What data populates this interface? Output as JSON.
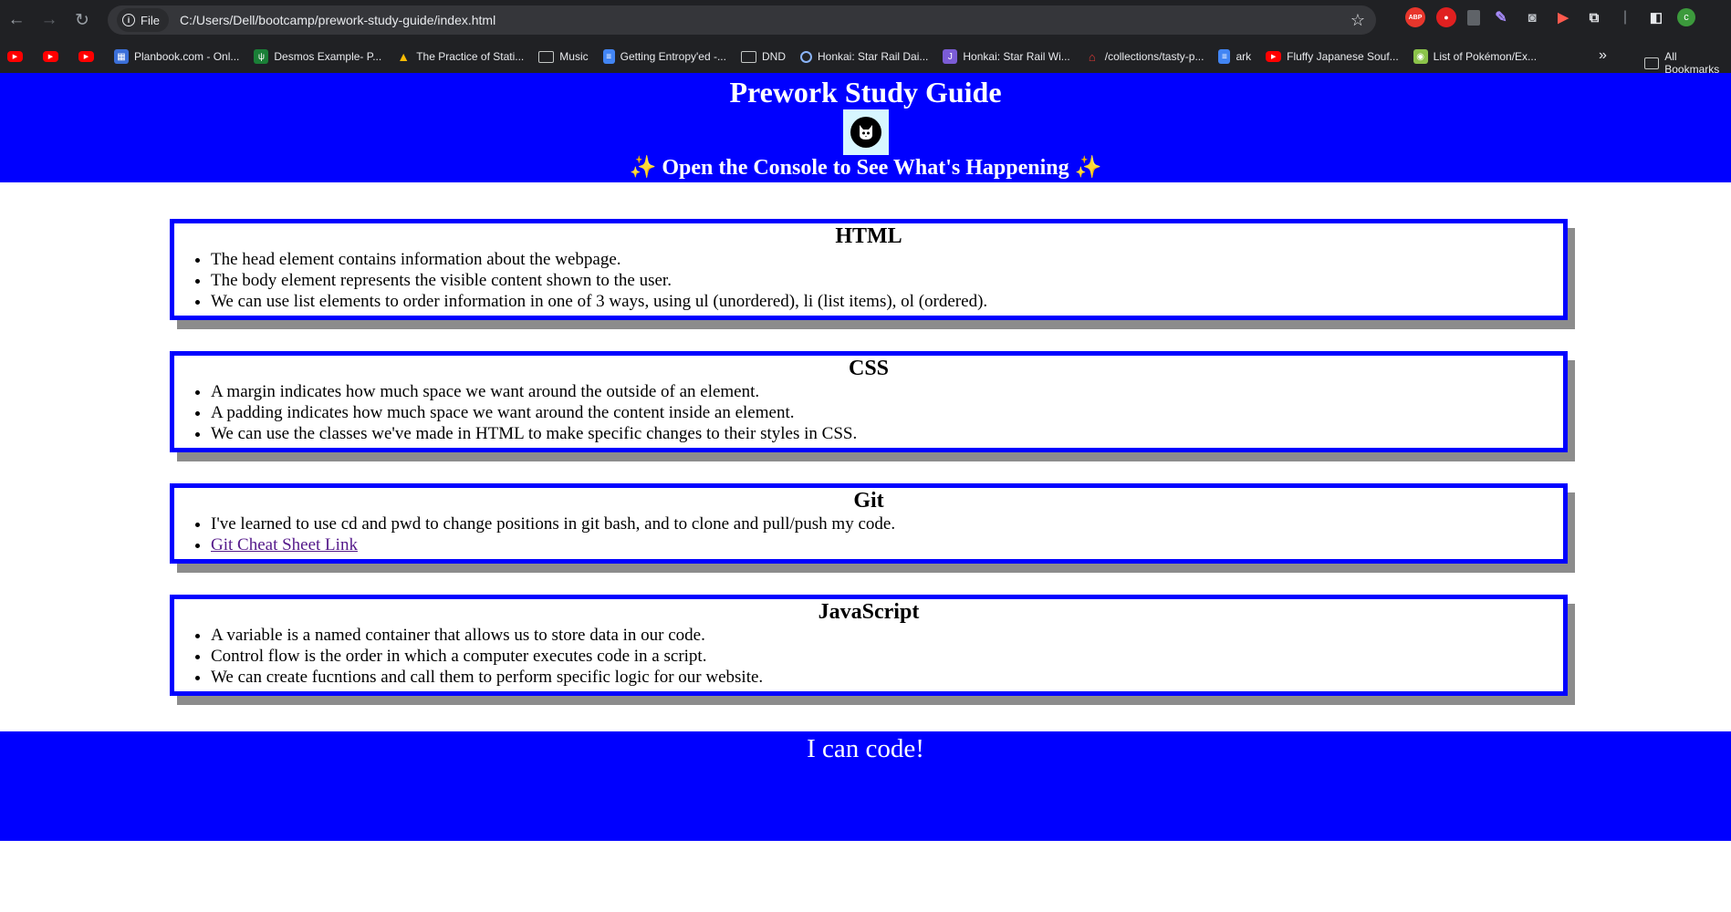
{
  "browser": {
    "site_chip": "File",
    "url": "C:/Users/Dell/bootcamp/prework-study-guide/index.html",
    "profile_initial": "c",
    "bookmarks": [
      {
        "label": "",
        "icon": "youtube-icon"
      },
      {
        "label": "",
        "icon": "youtube-icon"
      },
      {
        "label": "",
        "icon": "youtube-icon"
      },
      {
        "label": "Planbook.com - Onl...",
        "icon": "planbook-icon"
      },
      {
        "label": "Desmos Example- P...",
        "icon": "desmos-icon"
      },
      {
        "label": "The Practice of Stati...",
        "icon": "drive-icon"
      },
      {
        "label": "Music",
        "icon": "folder-icon"
      },
      {
        "label": "Getting Entropy'ed -...",
        "icon": "doc-icon"
      },
      {
        "label": "DND",
        "icon": "folder-icon"
      },
      {
        "label": "Honkai: Star Rail Dai...",
        "icon": "circle-icon"
      },
      {
        "label": "Honkai: Star Rail Wi...",
        "icon": "wiki-icon"
      },
      {
        "label": "/collections/tasty-p...",
        "icon": "hat-icon"
      },
      {
        "label": "ark",
        "icon": "doc-icon"
      },
      {
        "label": "Fluffy Japanese Souf...",
        "icon": "youtube-icon"
      },
      {
        "label": "List of Pokémon/Ex...",
        "icon": "pokemon-icon"
      }
    ],
    "all_bookmarks": "All Bookmarks"
  },
  "header": {
    "title": "Prework Study Guide",
    "subtitle": "Open the Console to See What's Happening",
    "sparkle": "✨"
  },
  "sections": [
    {
      "title": "HTML",
      "items": [
        "The head element contains information about the webpage.",
        "The body element represents the visible content shown to the user.",
        "We can use list elements to order information in one of 3 ways, using ul (unordered), li (list items), ol (ordered)."
      ]
    },
    {
      "title": "CSS",
      "items": [
        "A margin indicates how much space we want around the outside of an element.",
        "A padding indicates how much space we want around the content inside an element.",
        "We can use the classes we've made in HTML to make specific changes to their styles in CSS."
      ]
    },
    {
      "title": "Git",
      "items": [
        "I've learned to use cd and pwd to change positions in git bash, and to clone and pull/push my code."
      ],
      "link_text": "Git Cheat Sheet Link"
    },
    {
      "title": "JavaScript",
      "items": [
        "A variable is a named container that allows us to store data in our code.",
        "Control flow is the order in which a computer executes code in a script.",
        "We can create fucntions and call them to perform specific logic for our website."
      ]
    }
  ],
  "footer": {
    "text": "I can code!"
  },
  "colors": {
    "brand_blue": "#0000ff",
    "card_shadow": "#8c8c8c",
    "logo_bg": "#d7f6ff"
  }
}
